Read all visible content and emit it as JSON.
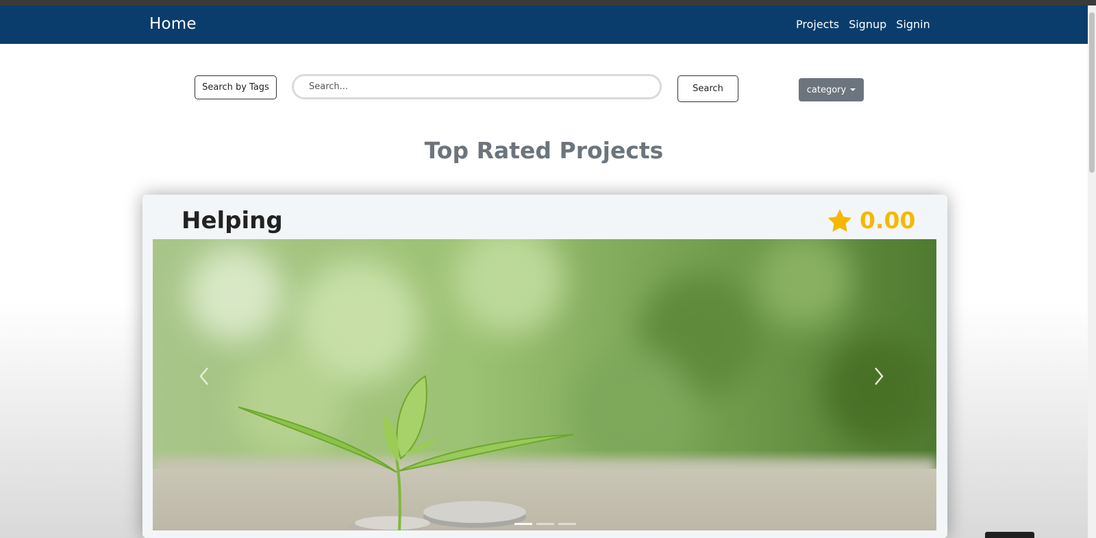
{
  "navbar": {
    "brand": "Home",
    "links": [
      "Projects",
      "Signup",
      "Signin"
    ],
    "color": "#0a3d6b"
  },
  "search": {
    "tags_button": "Search by Tags",
    "placeholder": "Search...",
    "submit_label": "Search",
    "category_label": "category"
  },
  "section": {
    "heading": "Top Rated Projects"
  },
  "project": {
    "title": "Helping",
    "rating": "0.00",
    "rating_color": "#f5b800",
    "rating_icon": "star-icon",
    "carousel": {
      "active_index": 0,
      "slide_count": 3,
      "image": "plant-sprout-coins-photo"
    }
  }
}
